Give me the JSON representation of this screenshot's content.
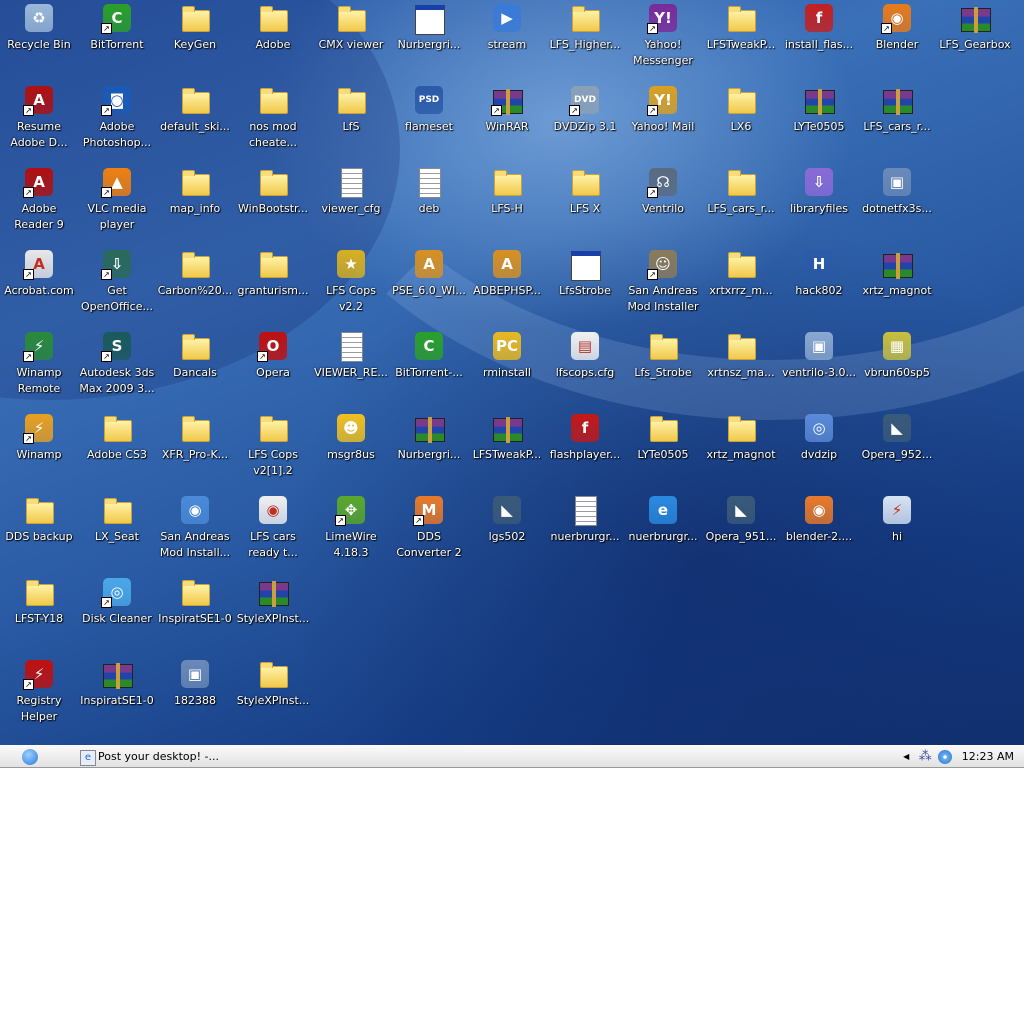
{
  "desktop": {
    "rows": [
      [
        {
          "label": "Recycle Bin",
          "icon": "recycle-bin-icon",
          "color": "#9ab8d8",
          "glyph": "♻"
        },
        {
          "label": "BitTorrent",
          "icon": "bittorrent-icon",
          "color": "#2aa02a",
          "glyph": "C",
          "shortcut": true
        },
        {
          "label": "KeyGen",
          "icon": "folder-icon"
        },
        {
          "label": "Adobe",
          "icon": "folder-icon"
        },
        {
          "label": "CMX viewer",
          "icon": "folder-icon"
        },
        {
          "label": "Nurbergri...",
          "icon": "window-icon"
        },
        {
          "label": "stream",
          "icon": "media-player-icon",
          "color": "#3a7ad8",
          "glyph": "▶"
        },
        {
          "label": "LFS_Higher...",
          "icon": "folder-icon"
        },
        {
          "label": "Yahoo!\nMessenger",
          "icon": "yahoo-messenger-icon",
          "color": "#7a2a9a",
          "glyph": "Y!",
          "shortcut": true
        },
        {
          "label": "LFSTweakP...",
          "icon": "folder-icon"
        },
        {
          "label": "install_flas...",
          "icon": "flash-installer-icon",
          "color": "#c42020",
          "glyph": "f"
        },
        {
          "label": "Blender",
          "icon": "blender-icon",
          "color": "#e87a1a",
          "glyph": "◉",
          "shortcut": true
        },
        {
          "label": "LFS_Gearbox",
          "icon": "archive-icon"
        }
      ],
      [
        {
          "label": "Resume\nAdobe D...",
          "icon": "adobe-reader-icon",
          "color": "#b01010",
          "glyph": "A",
          "shortcut": true
        },
        {
          "label": "Adobe\nPhotoshop...",
          "icon": "camera-icon",
          "color": "#1a5ab8",
          "glyph": "◙",
          "shortcut": true
        },
        {
          "label": "default_ski...",
          "icon": "folder-icon"
        },
        {
          "label": "nos mod\ncheate...",
          "icon": "folder-icon"
        },
        {
          "label": "LfS",
          "icon": "folder-icon"
        },
        {
          "label": "flameset",
          "icon": "psd-file-icon",
          "color": "#2a5aa8",
          "glyph": "PSD"
        },
        {
          "label": "WinRAR",
          "icon": "archive-icon",
          "shortcut": true
        },
        {
          "label": "DVDZip 3.1",
          "icon": "dvd-icon",
          "color": "#8aa0b8",
          "glyph": "DVD",
          "shortcut": true
        },
        {
          "label": "Yahoo! Mail",
          "icon": "mailbox-icon",
          "color": "#d8a020",
          "glyph": "Y!",
          "shortcut": true
        },
        {
          "label": "LX6",
          "icon": "folder-icon"
        },
        {
          "label": "LYTe0505",
          "icon": "archive-icon"
        },
        {
          "label": "LFS_cars_r...",
          "icon": "archive-icon"
        },
        null
      ],
      [
        {
          "label": "Adobe\nReader 9",
          "icon": "adobe-reader-icon",
          "color": "#b01010",
          "glyph": "A",
          "shortcut": true
        },
        {
          "label": "VLC media\nplayer",
          "icon": "vlc-cone-icon",
          "color": "#f08010",
          "glyph": "▲",
          "shortcut": true
        },
        {
          "label": "map_info",
          "icon": "folder-icon"
        },
        {
          "label": "WinBootstr...",
          "icon": "folder-icon"
        },
        {
          "label": "viewer_cfg",
          "icon": "notepad-icon"
        },
        {
          "label": "deb",
          "icon": "notepad-icon"
        },
        {
          "label": "LFS-H",
          "icon": "folder-icon"
        },
        {
          "label": "LFS X",
          "icon": "folder-icon"
        },
        {
          "label": "Ventrilo",
          "icon": "headset-icon",
          "color": "#5a6a80",
          "glyph": "☊",
          "shortcut": true
        },
        {
          "label": "LFS_cars_r...",
          "icon": "folder-icon"
        },
        {
          "label": "libraryfiles",
          "icon": "installer-icon",
          "color": "#8a6ad8",
          "glyph": "⇩"
        },
        {
          "label": "dotnetfx3s...",
          "icon": "setup-icon",
          "color": "#6a8ab8",
          "glyph": "▣"
        },
        null
      ],
      [
        {
          "label": "Acrobat.com",
          "icon": "acrobat-icon",
          "color": "#e8e8e8",
          "glyph": "A",
          "shortcut": true
        },
        {
          "label": "Get\nOpenOffice...",
          "icon": "openoffice-icon",
          "color": "#2a6a5a",
          "glyph": "⇩",
          "shortcut": true
        },
        {
          "label": "Carbon%20...",
          "icon": "folder-icon"
        },
        {
          "label": "granturism...",
          "icon": "folder-icon"
        },
        {
          "label": "LFS Cops\nv2.2",
          "icon": "police-badge-icon",
          "color": "#d8b020",
          "glyph": "★"
        },
        {
          "label": "PSE_6.0_WI...",
          "icon": "adobe-setup-icon",
          "color": "#d89020",
          "glyph": "A"
        },
        {
          "label": "ADBEPHSP...",
          "icon": "adobe-setup-icon",
          "color": "#d89020",
          "glyph": "A"
        },
        {
          "label": "LfsStrobe",
          "icon": "window-icon"
        },
        {
          "label": "San Andreas\nMod Installer",
          "icon": "sa-character-icon",
          "color": "#8a7a5a",
          "glyph": "☺",
          "shortcut": true
        },
        {
          "label": "xrtxrrz_m...",
          "icon": "folder-icon"
        },
        {
          "label": "hack802",
          "icon": "hack-icon",
          "color": "#2a5aa8",
          "glyph": "H"
        },
        {
          "label": "xrtz_magnot",
          "icon": "archive-icon"
        },
        null
      ],
      [
        {
          "label": "Winamp\nRemote",
          "icon": "winamp-remote-icon",
          "color": "#2a8a3a",
          "glyph": "⚡",
          "shortcut": true
        },
        {
          "label": "Autodesk 3ds\nMax 2009 3...",
          "icon": "3ds-max-icon",
          "color": "#1a5a5a",
          "glyph": "S",
          "shortcut": true
        },
        {
          "label": "Dancals",
          "icon": "folder-icon"
        },
        {
          "label": "Opera",
          "icon": "opera-icon",
          "color": "#c01010",
          "glyph": "O",
          "shortcut": true
        },
        {
          "label": "VIEWER_RE...",
          "icon": "notepad-icon"
        },
        {
          "label": "BitTorrent-...",
          "icon": "bittorrent-icon",
          "color": "#2aa02a",
          "glyph": "C"
        },
        {
          "label": "rminstall",
          "icon": "rm-installer-icon",
          "color": "#e8b820",
          "glyph": "PC"
        },
        {
          "label": "lfscops.cfg",
          "icon": "config-file-icon",
          "color": "#f0f0f0",
          "glyph": "▤"
        },
        {
          "label": "Lfs_Strobe",
          "icon": "folder-icon"
        },
        {
          "label": "xrtnsz_ma...",
          "icon": "folder-icon"
        },
        {
          "label": "ventrilo-3.0...",
          "icon": "setup-icon",
          "color": "#8aa8d0",
          "glyph": "▣"
        },
        {
          "label": "vbrun60sp5",
          "icon": "package-icon",
          "color": "#c8c040",
          "glyph": "▦"
        },
        null
      ],
      [
        {
          "label": "Winamp",
          "icon": "winamp-icon",
          "color": "#e8a020",
          "glyph": "⚡",
          "shortcut": true
        },
        {
          "label": "Adobe CS3",
          "icon": "folder-icon"
        },
        {
          "label": "XFR_Pro-K...",
          "icon": "folder-icon"
        },
        {
          "label": "LFS Cops\nv2[1].2",
          "icon": "folder-icon"
        },
        {
          "label": "msgr8us",
          "icon": "yahoo-smiley-icon",
          "color": "#f0c020",
          "glyph": "☻"
        },
        {
          "label": "Nurbergri...",
          "icon": "archive-icon"
        },
        {
          "label": "LFSTweakP...",
          "icon": "archive-icon"
        },
        {
          "label": "flashplayer...",
          "icon": "flash-icon",
          "color": "#c41818",
          "glyph": "f"
        },
        {
          "label": "LYTe0505",
          "icon": "folder-icon"
        },
        {
          "label": "xrtz_magnot",
          "icon": "folder-icon"
        },
        {
          "label": "dvdzip",
          "icon": "dvdzip-setup-icon",
          "color": "#5a8ad8",
          "glyph": "◎"
        },
        {
          "label": "Opera_952...",
          "icon": "opera-installer-icon",
          "color": "#3a5a7a",
          "glyph": "◣"
        },
        null
      ],
      [
        {
          "label": "DDS backup",
          "icon": "folder-icon"
        },
        {
          "label": "LX_Seat",
          "icon": "folder-icon"
        },
        {
          "label": "San Andreas\nMod Install...",
          "icon": "computer-cd-icon",
          "color": "#4a8ad8",
          "glyph": "◉"
        },
        {
          "label": "LFS cars\nready t...",
          "icon": "blender-file-icon",
          "color": "#f0f0f0",
          "glyph": "◉"
        },
        {
          "label": "LimeWire\n4.18.3",
          "icon": "limewire-icon",
          "color": "#5aa82a",
          "glyph": "✥",
          "shortcut": true
        },
        {
          "label": "DDS\nConverter 2",
          "icon": "blocks-icon",
          "color": "#e87a2a",
          "glyph": "M",
          "shortcut": true
        },
        {
          "label": "lgs502",
          "icon": "opera-installer-icon",
          "color": "#3a5a7a",
          "glyph": "◣"
        },
        {
          "label": "nuerbrurgr...",
          "icon": "notepad-icon"
        },
        {
          "label": "nuerbrurgr...",
          "icon": "ie-document-icon",
          "color": "#2a8ae0",
          "glyph": "e"
        },
        {
          "label": "Opera_951...",
          "icon": "opera-installer-icon",
          "color": "#3a5a7a",
          "glyph": "◣"
        },
        {
          "label": "blender-2....",
          "icon": "blender-installer-icon",
          "color": "#e87a2a",
          "glyph": "◉"
        },
        {
          "label": "hi",
          "icon": "winamp-file-icon",
          "color": "#d8e4f4",
          "glyph": "⚡"
        },
        null
      ],
      [
        {
          "label": "LFST-Y18",
          "icon": "folder-icon"
        },
        {
          "label": "Disk Cleaner",
          "icon": "disk-cleaner-icon",
          "color": "#4aa8e8",
          "glyph": "◎",
          "shortcut": true
        },
        {
          "label": "InspiratSE1-0",
          "icon": "folder-icon"
        },
        {
          "label": "StyleXPInst...",
          "icon": "archive-icon"
        },
        null,
        null,
        null,
        null,
        null,
        null,
        null,
        null,
        null
      ],
      [
        {
          "label": "Registry\nHelper",
          "icon": "registry-helper-icon",
          "color": "#c01010",
          "glyph": "⚡",
          "shortcut": true
        },
        {
          "label": "InspiratSE1-0",
          "icon": "archive-icon"
        },
        {
          "label": "182388",
          "icon": "setup-icon",
          "color": "#6a8ab8",
          "glyph": "▣"
        },
        {
          "label": "StyleXPInst...",
          "icon": "folder-icon"
        },
        null,
        null,
        null,
        null,
        null,
        null,
        null,
        null,
        null
      ]
    ]
  },
  "taskbar": {
    "start_icon": "apple-logo-icon",
    "task_label": "Post your desktop! -...",
    "task_icon": "internet-explorer-icon",
    "clock": "12:23 AM"
  }
}
